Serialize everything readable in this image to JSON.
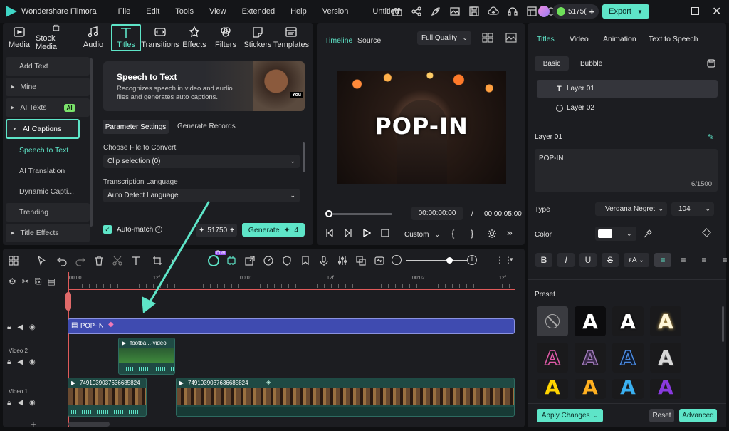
{
  "app": {
    "name": "Wondershare Filmora",
    "project": "Untitled",
    "credits": "5175(",
    "export_label": "Export"
  },
  "menu": [
    "File",
    "Edit",
    "Tools",
    "View",
    "Extended",
    "Help",
    "Version"
  ],
  "media_tabs": [
    {
      "label": "Media",
      "icon": "media-icon"
    },
    {
      "label": "Stock Media",
      "icon": "stock-media-icon"
    },
    {
      "label": "Audio",
      "icon": "audio-icon"
    },
    {
      "label": "Titles",
      "icon": "titles-icon"
    },
    {
      "label": "Transitions",
      "icon": "transitions-icon"
    },
    {
      "label": "Effects",
      "icon": "effects-icon"
    },
    {
      "label": "Filters",
      "icon": "filters-icon"
    },
    {
      "label": "Stickers",
      "icon": "stickers-icon"
    },
    {
      "label": "Templates",
      "icon": "templates-icon"
    }
  ],
  "sidebar": {
    "add_text": "Add Text",
    "mine": "Mine",
    "ai_texts": "AI Texts",
    "ai_badge": "AI",
    "ai_captions": "AI Captions",
    "speech_to_text": "Speech to Text",
    "ai_translation": "AI Translation",
    "dynamic_captions": "Dynamic Capti...",
    "trending": "Trending",
    "title_effects": "Title Effects"
  },
  "speech_panel": {
    "title": "Speech to Text",
    "description": "Recognizes speech in video and audio files and generates auto captions.",
    "thumb_label": "You",
    "tab_params": "Parameter Settings",
    "tab_records": "Generate Records",
    "file_label": "Choose File to Convert",
    "file_value": "Clip selection (0)",
    "lang_label": "Transcription Language",
    "lang_value": "Auto Detect Language",
    "automatch": "Auto-match",
    "credits": "51750",
    "generate": "Generate",
    "generate_cost": "4"
  },
  "player": {
    "tab_timeline": "Timeline",
    "tab_source": "Source",
    "quality": "Full Quality",
    "overlay_text": "POP-IN",
    "current_time": "00:00:00:00",
    "separator": "/",
    "total_time": "00:00:05:00",
    "zoom": "Custom"
  },
  "inspector": {
    "tabs": [
      "Titles",
      "Video",
      "Animation",
      "Text to Speech"
    ],
    "subtabs": [
      "Basic",
      "Bubble"
    ],
    "layers": [
      "Layer 01",
      "Layer 02"
    ],
    "layer_heading": "Layer 01",
    "text_value": "POP-IN",
    "char_count": "6/1500",
    "type_label": "Type",
    "font": "Verdana Negret",
    "font_size": "104",
    "color_label": "Color",
    "preset_label": "Preset",
    "apply": "Apply Changes",
    "reset": "Reset",
    "advanced": "Advanced",
    "colors": {
      "accent": "#5ee5c8",
      "selected_text": "#ffffff"
    }
  },
  "timeline": {
    "ruler": [
      "00:00",
      "12f",
      "00:01",
      "12f",
      "00:02",
      "12f"
    ],
    "title_clip": "POP-IN",
    "video2_label": "Video 2",
    "video2_clip": "footba...-video",
    "video1_label": "Video 1",
    "video1_clip_a": "7491039037636685824",
    "video1_clip_b": "7491039037636685824",
    "add_track": "+",
    "badge_free": "Free"
  }
}
